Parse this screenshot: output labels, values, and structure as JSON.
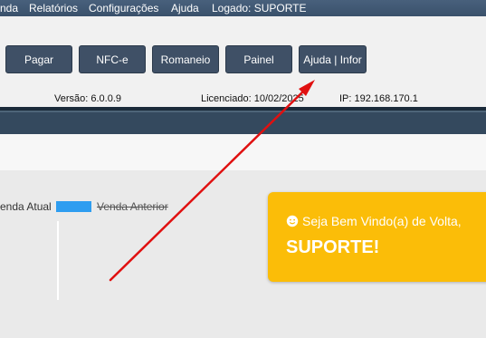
{
  "menu": {
    "items": [
      "nda",
      "Relatórios",
      "Configurações",
      "Ajuda",
      "Logado: SUPORTE"
    ]
  },
  "toolbar": {
    "buttons": [
      "Pagar",
      "NFC-e",
      "Romaneio",
      "Painel",
      "Ajuda | Infor"
    ]
  },
  "info": {
    "version": "Versão: 6.0.0.9",
    "license": "Licenciado: 10/02/2025",
    "ip": "IP: 192.168.170.1"
  },
  "chart_data": {
    "type": "bar",
    "legend": [
      "enda Atual",
      "Venda Anterior"
    ],
    "legend_placement": "top",
    "colors": {
      "current": "#2e9df0"
    }
  },
  "welcome": {
    "greeting": "Seja Bem Vindo(a) de Volta,",
    "name": "SUPORTE!",
    "background": "#fbbd08"
  },
  "annotation": {
    "arrow_color": "#e01010"
  }
}
